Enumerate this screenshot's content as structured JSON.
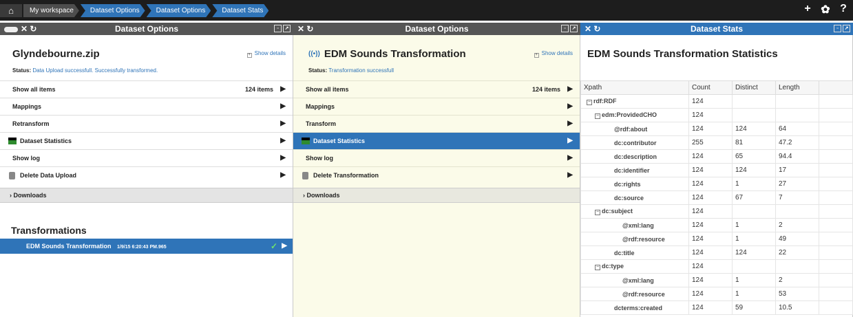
{
  "topbar": {
    "home_icon": "home-icon",
    "breadcrumbs": [
      "My workspace",
      "Dataset Options",
      "Dataset Options",
      "Dataset Stats"
    ],
    "actions": [
      "+",
      "✿",
      "?"
    ]
  },
  "panel1": {
    "header": "Dataset Options",
    "title": "Glyndebourne.zip",
    "show_details": "Show details",
    "status_label": "Status:",
    "status_text": "Data Upload successfull. Successfully transformed.",
    "menu": [
      {
        "label": "Show all items",
        "count": "124 items"
      },
      {
        "label": "Mappings"
      },
      {
        "label": "Retransform"
      },
      {
        "label": "Dataset Statistics"
      },
      {
        "label": "Show log"
      },
      {
        "label": "Delete Data Upload"
      }
    ],
    "downloads": "Downloads",
    "transformations_title": "Transformations",
    "transformation": {
      "name": "EDM Sounds Transformation",
      "timestamp": "1/9/15 6:20:43 PM.965"
    }
  },
  "panel2": {
    "header": "Dataset Options",
    "title": "EDM Sounds Transformation",
    "show_details": "Show details",
    "status_label": "Status:",
    "status_text": "Transformation successfull",
    "menu": [
      {
        "label": "Show all items",
        "count": "124 items"
      },
      {
        "label": "Mappings"
      },
      {
        "label": "Transform"
      },
      {
        "label": "Dataset Statistics"
      },
      {
        "label": "Show log"
      },
      {
        "label": "Delete Transformation"
      }
    ],
    "downloads": "Downloads"
  },
  "panel3": {
    "header": "Dataset Stats",
    "title": "EDM Sounds Transformation  Statistics",
    "columns": [
      "Xpath",
      "Count",
      "Distinct",
      "Length"
    ],
    "rows": [
      {
        "xpath": "rdf:RDF",
        "count": "124",
        "distinct": "",
        "length": ""
      },
      {
        "xpath": "edm:ProvidedCHO",
        "count": "124",
        "distinct": "",
        "length": ""
      },
      {
        "xpath": "@rdf:about",
        "count": "124",
        "distinct": "124",
        "length": "64"
      },
      {
        "xpath": "dc:contributor",
        "count": "255",
        "distinct": "81",
        "length": "47.2"
      },
      {
        "xpath": "dc:description",
        "count": "124",
        "distinct": "65",
        "length": "94.4"
      },
      {
        "xpath": "dc:identifier",
        "count": "124",
        "distinct": "124",
        "length": "17"
      },
      {
        "xpath": "dc:rights",
        "count": "124",
        "distinct": "1",
        "length": "27"
      },
      {
        "xpath": "dc:source",
        "count": "124",
        "distinct": "67",
        "length": "7"
      },
      {
        "xpath": "dc:subject",
        "count": "124",
        "distinct": "",
        "length": ""
      },
      {
        "xpath": "@xml:lang",
        "count": "124",
        "distinct": "1",
        "length": "2"
      },
      {
        "xpath": "@rdf:resource",
        "count": "124",
        "distinct": "1",
        "length": "49"
      },
      {
        "xpath": "dc:title",
        "count": "124",
        "distinct": "124",
        "length": "22"
      },
      {
        "xpath": "dc:type",
        "count": "124",
        "distinct": "",
        "length": ""
      },
      {
        "xpath": "@xml:lang",
        "count": "124",
        "distinct": "1",
        "length": "2"
      },
      {
        "xpath": "@rdf:resource",
        "count": "124",
        "distinct": "1",
        "length": "53"
      },
      {
        "xpath": "dcterms:created",
        "count": "124",
        "distinct": "59",
        "length": "10.5"
      }
    ]
  },
  "colors": {
    "accent": "#2f74b8",
    "topbar": "#1d1d1d",
    "green": "#3a8d2a"
  }
}
